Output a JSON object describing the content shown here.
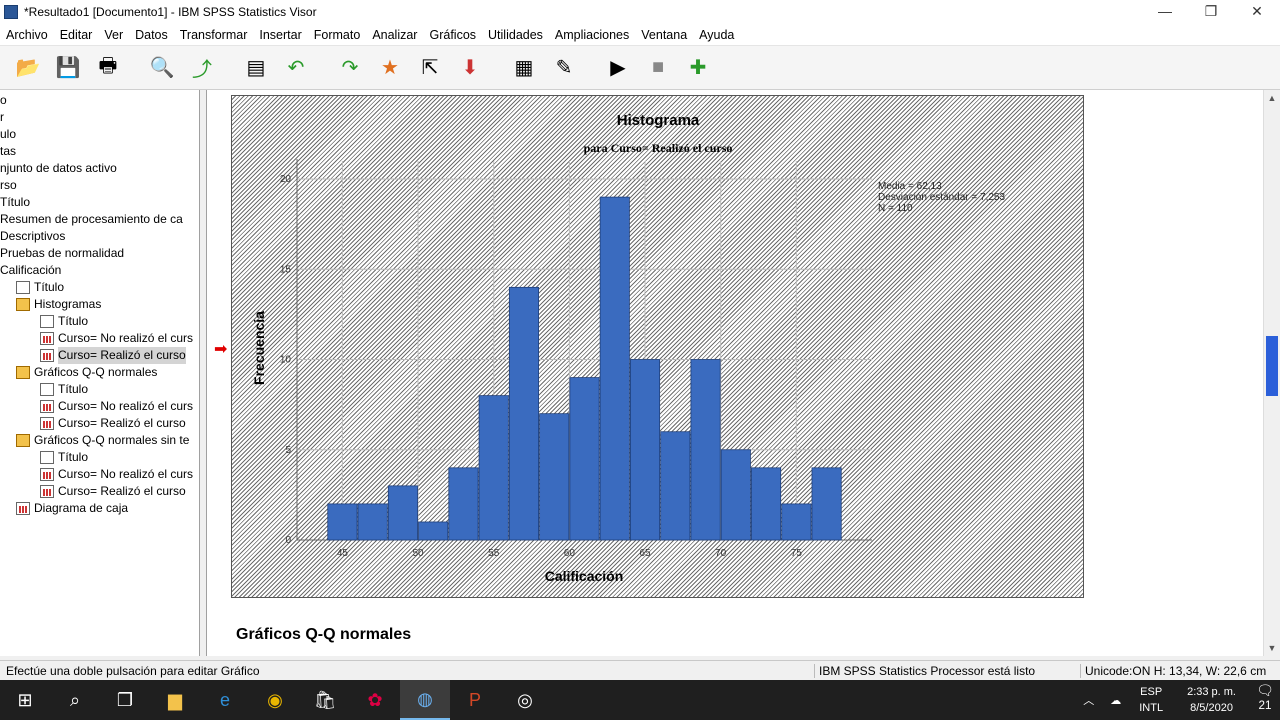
{
  "window": {
    "title": "*Resultado1 [Documento1] - IBM SPSS Statistics Visor",
    "minimize": "—",
    "restore": "❐",
    "close": "✕"
  },
  "menu": [
    "Archivo",
    "Editar",
    "Ver",
    "Datos",
    "Transformar",
    "Insertar",
    "Formato",
    "Analizar",
    "Gráficos",
    "Utilidades",
    "Ampliaciones",
    "Ventana",
    "Ayuda"
  ],
  "toolbar": {
    "icons": [
      "open-folder-icon",
      "save-icon",
      "print-icon",
      "print-preview-icon",
      "export-icon",
      "recall-dialog-icon",
      "undo-icon",
      "redo-icon",
      "goto-data-icon",
      "goto-case-icon",
      "goto-variable-icon",
      "variables-icon",
      "designate-window-icon",
      "create-title-icon",
      "stop-icon",
      "add-output-icon"
    ]
  },
  "outline": [
    {
      "text": "o",
      "indent": 0,
      "icon": "none"
    },
    {
      "text": "r",
      "indent": 0,
      "icon": "none"
    },
    {
      "text": "ulo",
      "indent": 0,
      "icon": "none"
    },
    {
      "text": "tas",
      "indent": 0,
      "icon": "none"
    },
    {
      "text": "njunto de datos activo",
      "indent": 0,
      "icon": "none"
    },
    {
      "text": "rso",
      "indent": 0,
      "icon": "none"
    },
    {
      "text": "Título",
      "indent": 0,
      "icon": "none"
    },
    {
      "text": "Resumen de procesamiento de ca",
      "indent": 0,
      "icon": "none"
    },
    {
      "text": "Descriptivos",
      "indent": 0,
      "icon": "none"
    },
    {
      "text": "Pruebas de normalidad",
      "indent": 0,
      "icon": "none"
    },
    {
      "text": "Calificación",
      "indent": 0,
      "icon": "none"
    },
    {
      "text": "Título",
      "indent": 1,
      "icon": "page"
    },
    {
      "text": "Histogramas",
      "indent": 1,
      "icon": "book"
    },
    {
      "text": "Título",
      "indent": 2,
      "icon": "page"
    },
    {
      "text": "Curso= No realizó el curs",
      "indent": 2,
      "icon": "chart"
    },
    {
      "text": "Curso= Realizó el curso",
      "indent": 2,
      "icon": "chart",
      "selected": true
    },
    {
      "text": "Gráficos Q-Q normales",
      "indent": 1,
      "icon": "book"
    },
    {
      "text": "Título",
      "indent": 2,
      "icon": "page"
    },
    {
      "text": "Curso= No realizó el curs",
      "indent": 2,
      "icon": "chart"
    },
    {
      "text": "Curso= Realizó el curso",
      "indent": 2,
      "icon": "chart"
    },
    {
      "text": "Gráficos Q-Q normales sin te",
      "indent": 1,
      "icon": "book"
    },
    {
      "text": "Título",
      "indent": 2,
      "icon": "page"
    },
    {
      "text": "Curso= No realizó el curs",
      "indent": 2,
      "icon": "chart"
    },
    {
      "text": "Curso= Realizó el curso",
      "indent": 2,
      "icon": "chart"
    },
    {
      "text": "Diagrama de caja",
      "indent": 1,
      "icon": "chart"
    }
  ],
  "chart_data": {
    "type": "bar",
    "title": "Histograma",
    "subtitle": "para Curso= Realizó el curso",
    "xlabel": "Calificación",
    "ylabel": "Frecuencia",
    "bin_start": 44,
    "bin_width": 2,
    "values": [
      2,
      2,
      3,
      1,
      4,
      8,
      14,
      7,
      9,
      19,
      10,
      6,
      10,
      5,
      4,
      2,
      4
    ],
    "xticks": [
      45,
      50,
      55,
      60,
      65,
      70,
      75
    ],
    "xtick_labels": [
      "45",
      "50",
      "55",
      "60",
      "65",
      "70",
      "75"
    ],
    "yticks": [
      0,
      5,
      10,
      15,
      20
    ],
    "xlim": [
      42,
      80
    ],
    "ylim": [
      0,
      21
    ],
    "bar_color": "#3a6bbf",
    "stats": [
      "Media = 62,13",
      "Desviación estándar = 7,253",
      "N = 110"
    ],
    "stats_position": "top-right",
    "grid": true
  },
  "next_section": "Gráficos Q-Q normales",
  "status": {
    "message": "Efectúe una doble pulsación para editar Gráfico",
    "processor": "IBM SPSS Statistics Processor está listo",
    "info": "Unicode:ON  H: 13,34, W: 22,6 cm"
  },
  "taskbar": {
    "lang1": "ESP",
    "lang2": "INTL",
    "time": "2:33 p. m.",
    "date": "8/5/2020",
    "notifications": "21"
  }
}
